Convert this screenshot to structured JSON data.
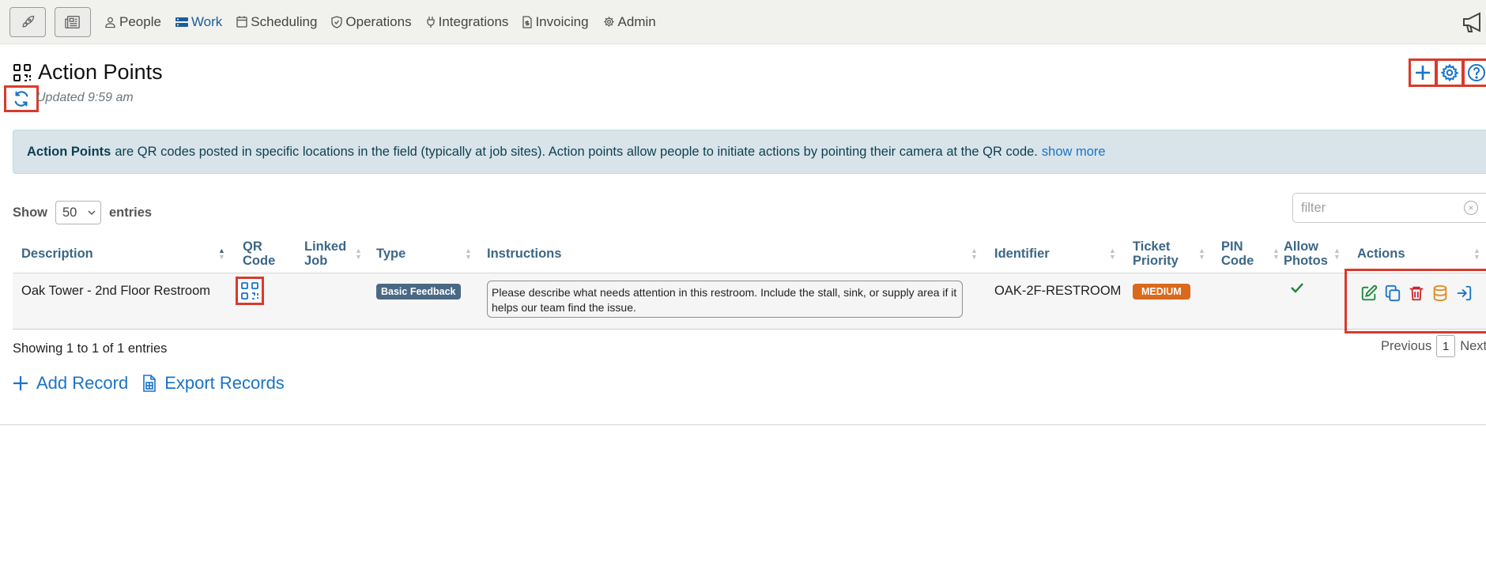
{
  "nav": {
    "items": [
      {
        "label": "People",
        "icon": "person-icon"
      },
      {
        "label": "Work",
        "icon": "stack-icon",
        "active": true
      },
      {
        "label": "Scheduling",
        "icon": "calendar-icon"
      },
      {
        "label": "Operations",
        "icon": "shield-icon"
      },
      {
        "label": "Integrations",
        "icon": "plug-icon"
      },
      {
        "label": "Invoicing",
        "icon": "invoice-icon"
      },
      {
        "label": "Admin",
        "icon": "gear-icon"
      }
    ]
  },
  "header": {
    "title": "Action Points",
    "updated": "Updated 9:59 am"
  },
  "info": {
    "bold": "Action Points",
    "text": "are QR codes posted in specific locations in the field (typically at job sites). Action points allow people to initiate actions by pointing their camera at the QR code.",
    "link": "show more"
  },
  "controls": {
    "show_label": "Show",
    "entries_value": "50",
    "entries_label": "entries",
    "filter_placeholder": "filter"
  },
  "table": {
    "columns": {
      "description": "Description",
      "qr_1": "QR",
      "qr_2": "Code",
      "linked_1": "Linked",
      "linked_2": "Job",
      "type": "Type",
      "instructions": "Instructions",
      "identifier": "Identifier",
      "priority_1": "Ticket",
      "priority_2": "Priority",
      "pin_1": "PIN",
      "pin_2": "Code",
      "photos_1": "Allow",
      "photos_2": "Photos",
      "actions": "Actions"
    },
    "rows": [
      {
        "description": "Oak Tower - 2nd Floor Restroom",
        "type": "Basic Feedback",
        "instructions": "Please describe what needs attention in this restroom. Include the stall, sink, or supply area if it helps our team find the issue.",
        "identifier": "OAK-2F-RESTROOM",
        "priority": "MEDIUM",
        "pin": "",
        "allow_photos": true
      }
    ]
  },
  "footer": {
    "showing": "Showing 1 to 1 of 1 entries",
    "previous": "Previous",
    "page": "1",
    "next": "Next",
    "add_record": "Add Record",
    "export_records": "Export Records"
  },
  "colors": {
    "accent": "#1a73c8",
    "highlight": "#d93a2b",
    "priority_medium": "#d9691b",
    "type_badge": "#4a6884",
    "success": "#19863d",
    "danger": "#c8232c",
    "warning": "#e08a1e"
  }
}
